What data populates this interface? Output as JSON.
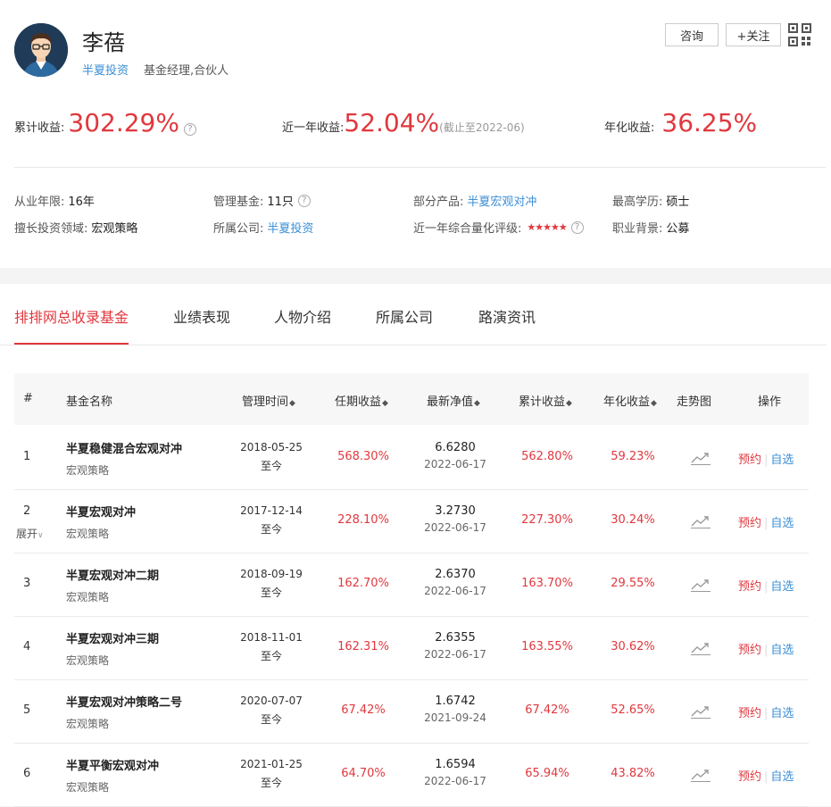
{
  "profile": {
    "name": "李蓓",
    "company": "半夏投资",
    "role": "基金经理,合伙人",
    "consult_label": "咨询",
    "follow_label": "+关注"
  },
  "metrics": {
    "cumulative_label": "累计收益:",
    "cumulative_value": "302.29%",
    "year_label": "近一年收益:",
    "year_value": "52.04%",
    "year_note": "(截止至2022-06)",
    "annual_label": "年化收益:",
    "annual_value": "36.25%"
  },
  "info": {
    "years_label": "从业年限:",
    "years_value": "16年",
    "funds_label": "管理基金:",
    "funds_value": "11只",
    "products_label": "部分产品:",
    "products_value": "半夏宏观对冲",
    "edu_label": "最高学历:",
    "edu_value": "硕士",
    "field_label": "擅长投资领域:",
    "field_value": "宏观策略",
    "company_label": "所属公司:",
    "company_value": "半夏投资",
    "rating_label": "近一年综合量化评级:",
    "rating_stars": "★★★★★",
    "bg_label": "职业背景:",
    "bg_value": "公募"
  },
  "tabs": [
    {
      "label": "排排网总收录基金"
    },
    {
      "label": "业绩表现"
    },
    {
      "label": "人物介绍"
    },
    {
      "label": "所属公司"
    },
    {
      "label": "路演资讯"
    }
  ],
  "table": {
    "headers": {
      "idx": "#",
      "name": "基金名称",
      "period": "管理时间",
      "tenure_return": "任期收益",
      "nav": "最新净值",
      "cum_return": "累计收益",
      "annual": "年化收益",
      "trend": "走势图",
      "ops": "操作"
    },
    "sort_glyph": "◆",
    "book_label": "预约",
    "watch_label": "自选",
    "expand_label": "展开",
    "rows": [
      {
        "idx": "1",
        "name": "半夏稳健混合宏观对冲",
        "strategy": "宏观策略",
        "start": "2018-05-25",
        "end": "至今",
        "tenure": "568.30%",
        "nav": "6.6280",
        "nav_date": "2022-06-17",
        "cum": "562.80%",
        "annual": "59.23%"
      },
      {
        "idx": "2",
        "name": "半夏宏观对冲",
        "strategy": "宏观策略",
        "start": "2017-12-14",
        "end": "至今",
        "tenure": "228.10%",
        "nav": "3.2730",
        "nav_date": "2022-06-17",
        "cum": "227.30%",
        "annual": "30.24%"
      },
      {
        "idx": "3",
        "name": "半夏宏观对冲二期",
        "strategy": "宏观策略",
        "start": "2018-09-19",
        "end": "至今",
        "tenure": "162.70%",
        "nav": "2.6370",
        "nav_date": "2022-06-17",
        "cum": "163.70%",
        "annual": "29.55%"
      },
      {
        "idx": "4",
        "name": "半夏宏观对冲三期",
        "strategy": "宏观策略",
        "start": "2018-11-01",
        "end": "至今",
        "tenure": "162.31%",
        "nav": "2.6355",
        "nav_date": "2022-06-17",
        "cum": "163.55%",
        "annual": "30.62%"
      },
      {
        "idx": "5",
        "name": "半夏宏观对冲策略二号",
        "strategy": "宏观策略",
        "start": "2020-07-07",
        "end": "至今",
        "tenure": "67.42%",
        "nav": "1.6742",
        "nav_date": "2021-09-24",
        "cum": "67.42%",
        "annual": "52.65%"
      },
      {
        "idx": "6",
        "name": "半夏平衡宏观对冲",
        "strategy": "宏观策略",
        "start": "2021-01-25",
        "end": "至今",
        "tenure": "64.70%",
        "nav": "1.6594",
        "nav_date": "2022-06-17",
        "cum": "65.94%",
        "annual": "43.82%"
      }
    ]
  },
  "colors": {
    "accent_red": "#e0383e",
    "link_blue": "#3b8fd6"
  }
}
